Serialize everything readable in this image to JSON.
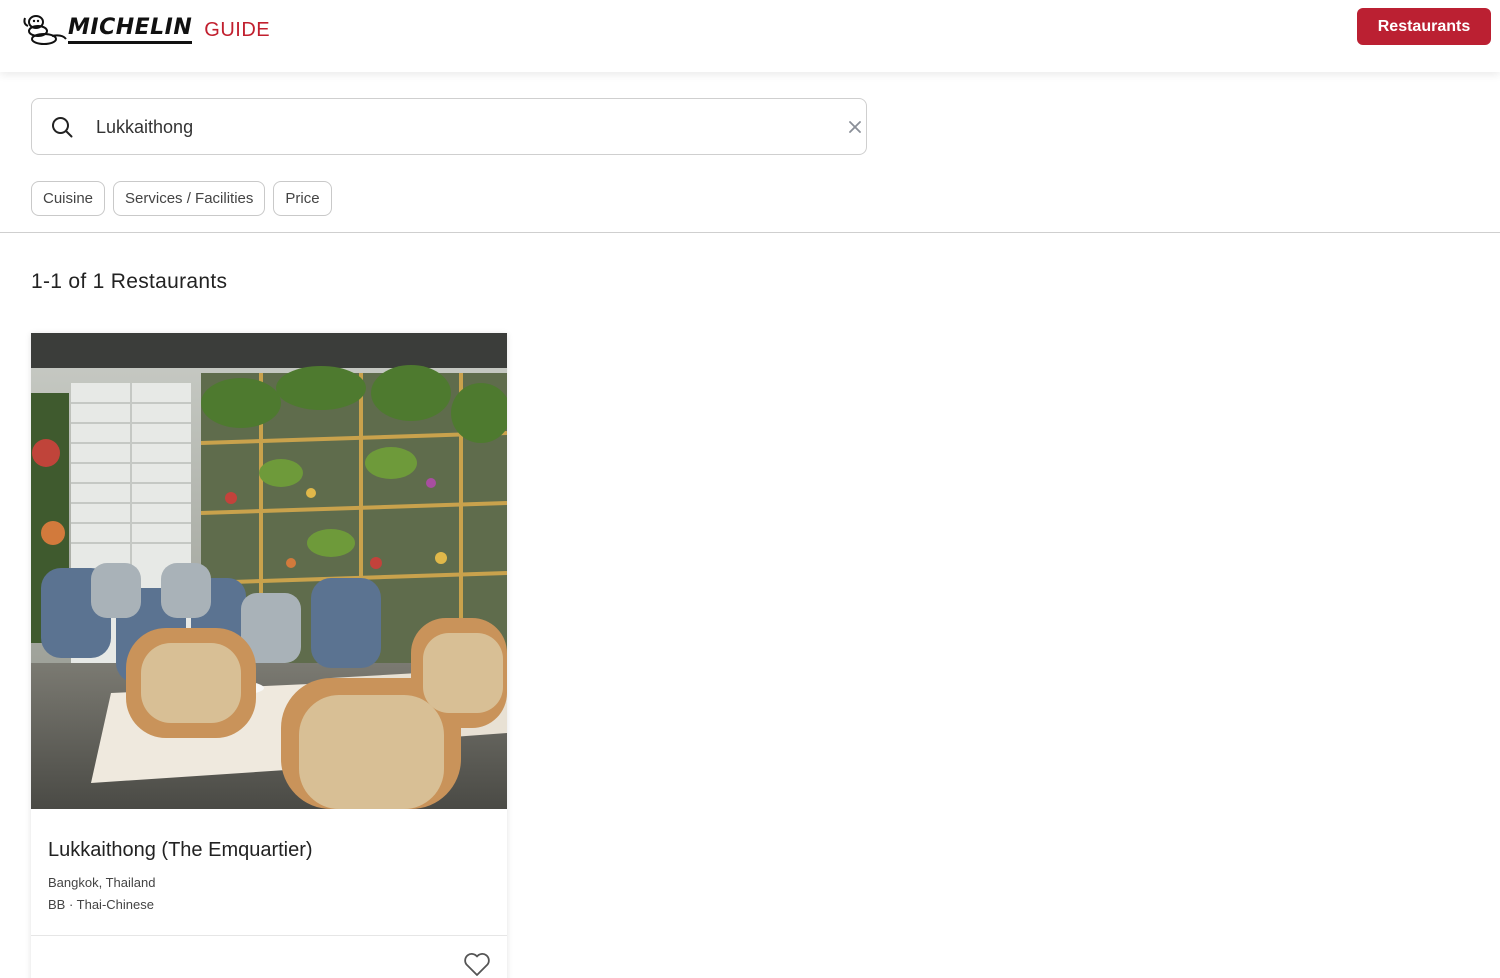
{
  "header": {
    "logo_word": "MICHELIN",
    "logo_guide": "GUIDE",
    "nav_button_label": "Restaurants",
    "accent_color": "#bb2032"
  },
  "search": {
    "value": "Lukkaithong",
    "search_icon": "search-icon",
    "clear_icon": "close-icon"
  },
  "filters": [
    {
      "label": "Cuisine"
    },
    {
      "label": "Services / Facilities"
    },
    {
      "label": "Price"
    }
  ],
  "results": {
    "count_text": "1-1 of 1 Restaurants"
  },
  "restaurants": [
    {
      "name": "Lukkaithong (The Emquartier)",
      "location": "Bangkok, Thailand",
      "meta": "BB · Thai-Chinese",
      "favorite_icon": "heart-icon"
    }
  ]
}
